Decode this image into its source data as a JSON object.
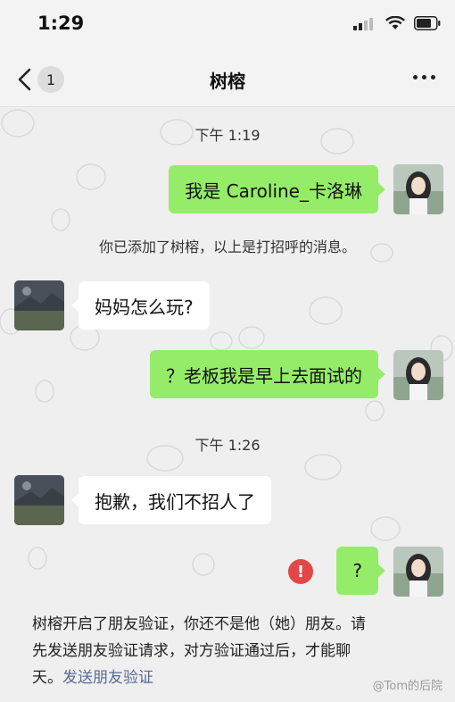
{
  "status_bar": {
    "time": "1:29"
  },
  "nav": {
    "unread_count": "1",
    "title": "树榕"
  },
  "messages": [
    {
      "type": "time",
      "text": "下午 1:19"
    },
    {
      "type": "me",
      "text": "我是 Caroline_卡洛琳"
    },
    {
      "type": "system",
      "text": "你已添加了树榕，以上是打招呼的消息。"
    },
    {
      "type": "other",
      "text": "妈妈怎么玩?"
    },
    {
      "type": "me",
      "text": "？老板我是早上去面试的"
    },
    {
      "type": "time",
      "text": "下午 1:26"
    },
    {
      "type": "other",
      "text": "抱歉，我们不招人了"
    },
    {
      "type": "me",
      "text": "?",
      "error": true
    }
  ],
  "verify_notice": {
    "line1": "树榕开启了朋友验证，你还不是他（她）朋友。请",
    "line2": "先发送朋友验证请求，对方验证通过后，才能聊",
    "line3": "天。",
    "link": "发送朋友验证"
  },
  "watermark": "@Tom的后院",
  "colors": {
    "my_bubble": "#95ec69",
    "other_bubble": "#ffffff",
    "error": "#e24646",
    "link": "#576b95"
  }
}
